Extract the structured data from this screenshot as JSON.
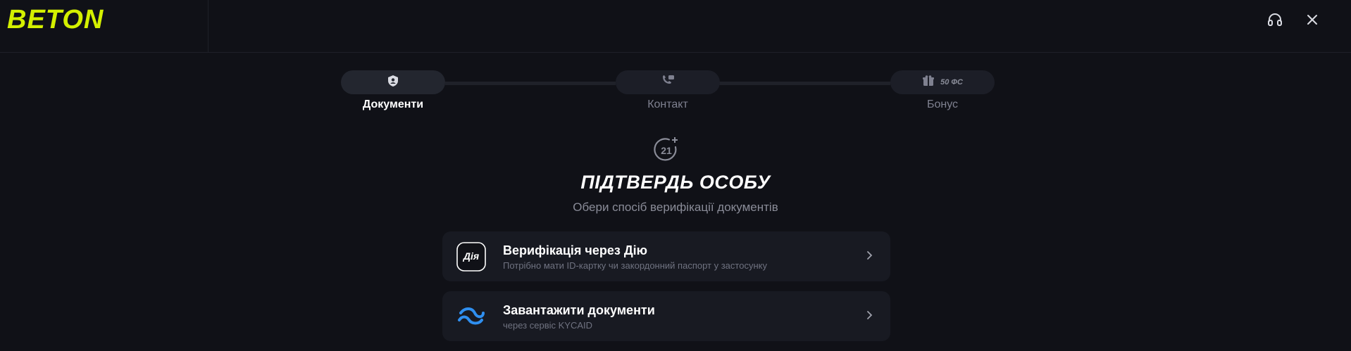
{
  "brand": {
    "name": "BETON",
    "accent": "#d4f000"
  },
  "header": {
    "icons": [
      "headset-icon",
      "close-icon"
    ]
  },
  "steps": [
    {
      "label": "Документи",
      "icon": "shield-user-icon",
      "active": true
    },
    {
      "label": "Контакт",
      "icon": "phone-chat-icon",
      "active": false
    },
    {
      "label": "Бонус",
      "icon": "gift-icon",
      "badge": "50 ФС",
      "active": false
    }
  ],
  "main": {
    "age_icon": "21-plus-icon",
    "title": "ПІДТВЕРДЬ ОСОБУ",
    "subtitle": "Обери спосіб верифікації документів"
  },
  "options": [
    {
      "icon": "diia-icon",
      "icon_text": "Дія",
      "title": "Верифікація через Дію",
      "subtitle": "Потрібно мати ID-картку чи закордонний паспорт у застосунку"
    },
    {
      "icon": "kycaid-icon",
      "title": "Завантажити документи",
      "subtitle": "через сервіс KYCAID"
    }
  ]
}
